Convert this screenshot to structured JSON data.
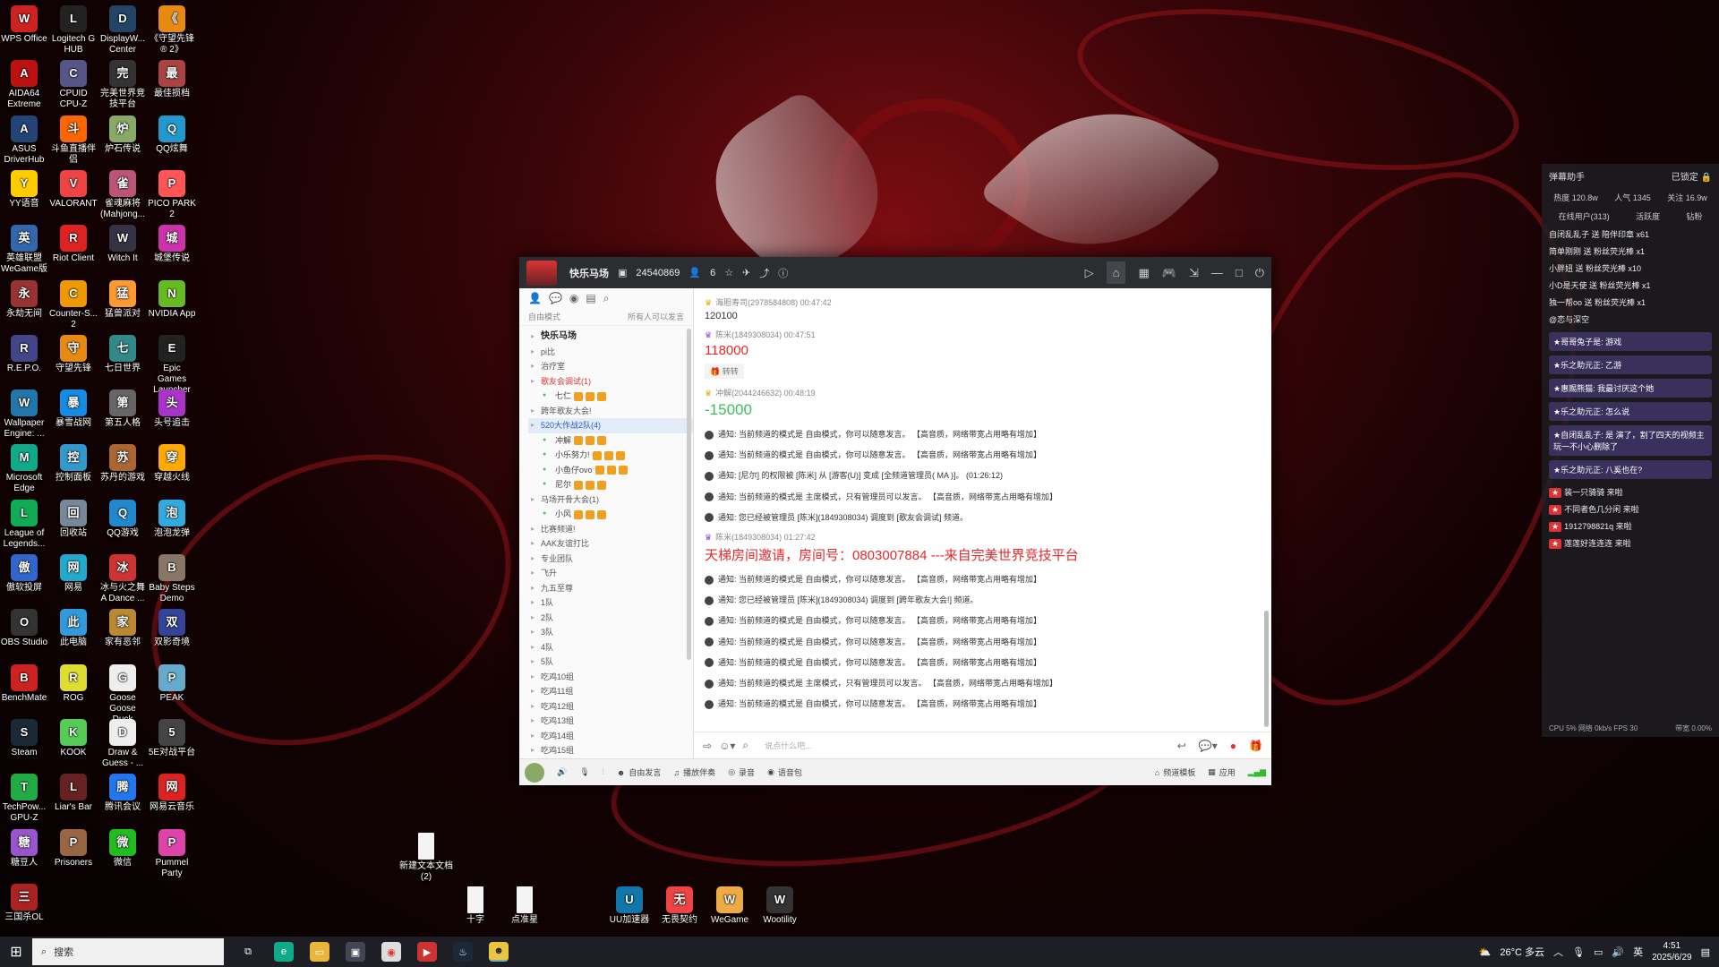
{
  "desktop": {
    "icons": [
      {
        "label": "WPS Office",
        "color": "#c22"
      },
      {
        "label": "Logitech G HUB",
        "color": "#222"
      },
      {
        "label": "DisplayW... Center",
        "color": "#246"
      },
      {
        "label": "《守望先锋® 2》",
        "color": "#e78a14"
      },
      {
        "label": "AIDA64 Extreme",
        "color": "#b11"
      },
      {
        "label": "CPUID CPU-Z",
        "color": "#558"
      },
      {
        "label": "完美世界竞技平台",
        "color": "#333"
      },
      {
        "label": "最佳损档",
        "color": "#a44"
      },
      {
        "label": "ASUS DriverHub",
        "color": "#247"
      },
      {
        "label": "斗鱼直播伴侣",
        "color": "#f60"
      },
      {
        "label": "炉石传说",
        "color": "#8a6"
      },
      {
        "label": "QQ炫舞",
        "color": "#29c"
      },
      {
        "label": "YY语音",
        "color": "#fc0"
      },
      {
        "label": "VALORANT",
        "color": "#e44"
      },
      {
        "label": "雀魂麻将(Mahjong...",
        "color": "#b57"
      },
      {
        "label": "PICO PARK 2",
        "color": "#f55"
      },
      {
        "label": "英雄联盟WeGame版",
        "color": "#36a"
      },
      {
        "label": "Riot Client",
        "color": "#d22"
      },
      {
        "label": "Witch It",
        "color": "#334"
      },
      {
        "label": "城堡传说",
        "color": "#c3a"
      },
      {
        "label": "永劫无间",
        "color": "#933"
      },
      {
        "label": "Counter-S... 2",
        "color": "#e90"
      },
      {
        "label": "猛兽派对",
        "color": "#f93"
      },
      {
        "label": "NVIDIA App",
        "color": "#6b2"
      },
      {
        "label": "R.E.P.O.",
        "color": "#448"
      },
      {
        "label": "守望先锋",
        "color": "#e78a14"
      },
      {
        "label": "七日世界",
        "color": "#388"
      },
      {
        "label": "Epic Games Launcher",
        "color": "#222"
      },
      {
        "label": "Wallpaper Engine: ...",
        "color": "#27a"
      },
      {
        "label": "暴雪战网",
        "color": "#148be5"
      },
      {
        "label": "第五人格",
        "color": "#666"
      },
      {
        "label": "头号追击",
        "color": "#a3c"
      },
      {
        "label": "Microsoft Edge",
        "color": "#1a8"
      },
      {
        "label": "控制面板",
        "color": "#39c"
      },
      {
        "label": "苏丹的游戏",
        "color": "#a63"
      },
      {
        "label": "穿越火线",
        "color": "#fa0"
      },
      {
        "label": "League of Legends...",
        "color": "#1a5"
      },
      {
        "label": "回收站",
        "color": "#789"
      },
      {
        "label": "QQ游戏",
        "color": "#28c"
      },
      {
        "label": "泡泡龙弹",
        "color": "#3ad"
      },
      {
        "label": "傲软投屏",
        "color": "#36c"
      },
      {
        "label": "网易",
        "color": "#2ac"
      },
      {
        "label": "冰与火之舞 A Dance ...",
        "color": "#c33"
      },
      {
        "label": "Baby Steps Demo",
        "color": "#876"
      },
      {
        "label": "OBS Studio",
        "color": "#333"
      },
      {
        "label": "此电脑",
        "color": "#39d"
      },
      {
        "label": "家有恶邻",
        "color": "#b83"
      },
      {
        "label": "双影奇境",
        "color": "#349"
      },
      {
        "label": "BenchMate",
        "color": "#c22"
      },
      {
        "label": "ROG",
        "color": "#dd3"
      },
      {
        "label": "Goose Goose Duck",
        "color": "#eee"
      },
      {
        "label": "PEAK",
        "color": "#6ac"
      },
      {
        "label": "Steam",
        "color": "#1b2838"
      },
      {
        "label": "KOOK",
        "color": "#5c5"
      },
      {
        "label": "Draw & Guess - ...",
        "color": "#eee"
      },
      {
        "label": "5E对战平台",
        "color": "#444"
      },
      {
        "label": "TechPow... GPU-Z",
        "color": "#2a4"
      },
      {
        "label": "Liar's Bar",
        "color": "#622"
      },
      {
        "label": "腾讯会议",
        "color": "#27e"
      },
      {
        "label": "网易云音乐",
        "color": "#d22"
      },
      {
        "label": "糖豆人",
        "color": "#95c"
      },
      {
        "label": "Prisoners",
        "color": "#964"
      },
      {
        "label": "微信",
        "color": "#2b2"
      },
      {
        "label": "Pummel Party",
        "color": "#d4a"
      },
      {
        "label": "三国杀OL",
        "color": "#a22"
      }
    ],
    "files": [
      {
        "label": "新建文本文档 (2)"
      },
      {
        "label": "十字"
      },
      {
        "label": "点准星"
      }
    ],
    "pinned": [
      {
        "label": "UU加速器",
        "color": "#17a"
      },
      {
        "label": "无畏契约",
        "color": "#e44"
      },
      {
        "label": "WeGame",
        "color": "#ea4"
      },
      {
        "label": "Wootility",
        "color": "#333"
      }
    ]
  },
  "app": {
    "channel_name": "快乐马场",
    "channel_id": "24540869",
    "user_count": "6",
    "mode": "自由模式",
    "mode_hint": "所有人可以发言",
    "channels": [
      {
        "name": "快乐马场",
        "kind": "root"
      },
      {
        "name": "pi比",
        "kind": "normal"
      },
      {
        "name": "治疗室",
        "kind": "normal"
      },
      {
        "name": "歌友会调试(1)",
        "kind": "red"
      },
      {
        "name": "七仁",
        "kind": "member"
      },
      {
        "name": "跨年歌友大会!",
        "kind": "normal"
      },
      {
        "name": "520大作战2队(4)",
        "kind": "sel"
      },
      {
        "name": "冲解",
        "kind": "member"
      },
      {
        "name": "小乐努力!",
        "kind": "member"
      },
      {
        "name": "小鱼仔ovo",
        "kind": "member"
      },
      {
        "name": "尼尔",
        "kind": "member"
      },
      {
        "name": "马场开骨大会(1)",
        "kind": "normal"
      },
      {
        "name": "小风",
        "kind": "member"
      },
      {
        "name": "比赛频道!",
        "kind": "normal"
      },
      {
        "name": "AAK友谊打比",
        "kind": "normal"
      },
      {
        "name": "专业团队",
        "kind": "normal"
      },
      {
        "name": "飞升",
        "kind": "normal"
      },
      {
        "name": "九五至尊",
        "kind": "normal"
      },
      {
        "name": "1队",
        "kind": "normal"
      },
      {
        "name": "2队",
        "kind": "normal"
      },
      {
        "name": "3队",
        "kind": "normal"
      },
      {
        "name": "4队",
        "kind": "normal"
      },
      {
        "name": "5队",
        "kind": "normal"
      },
      {
        "name": "吃鸡10组",
        "kind": "normal"
      },
      {
        "name": "吃鸡11组",
        "kind": "normal"
      },
      {
        "name": "吃鸡12组",
        "kind": "normal"
      },
      {
        "name": "吃鸡13组",
        "kind": "normal"
      },
      {
        "name": "吃鸡14组",
        "kind": "normal"
      },
      {
        "name": "吃鸡15组",
        "kind": "normal"
      }
    ],
    "messages": {
      "m1_head": "海胆寿司(2978584808)  00:47:42",
      "m1_body": "120100",
      "m2_head": "陈米(1849308034)  00:47:51",
      "m2_big": "118000",
      "m2_gift": "转转",
      "m3_head": "冲解(2044246632)  00:48:19",
      "m3_big": "-15000",
      "notices_a": [
        "通知: 当前频道的模式是 自由模式，你可以随意发言。 【高音质，网络带宽占用略有增加】",
        "通知: 当前频道的模式是 自由模式，你可以随意发言。 【高音质，网络带宽占用略有增加】",
        "通知: [尼尔] 的权限被 [陈米] 从 [游客(U)] 变成 [全频道管理员( MA )]。 (01:26:12)",
        "通知: 当前频道的模式是 主席模式，只有管理员可以发言。 【高音质，网络带宽占用略有增加】",
        "通知: 您已经被管理员 [陈米](1849308034) 调度到 [歌友会调试] 频道。"
      ],
      "m4_head": "陈米(1849308034)  01:27:42",
      "m4_big": "天梯房间邀请，房间号：0803007884 ---来自完美世界竞技平台",
      "notices_b": [
        "通知: 当前频道的模式是 自由模式，你可以随意发言。 【高音质，网络带宽占用略有增加】",
        "通知: 您已经被管理员 [陈米](1849308034) 调度到 [跨年歌友大会!] 频道。",
        "通知: 当前频道的模式是 自由模式，你可以随意发言。 【高音质，网络带宽占用略有增加】",
        "通知: 当前频道的模式是 自由模式，你可以随意发言。 【高音质，网络带宽占用略有增加】",
        "通知: 当前频道的模式是 自由模式，你可以随意发言。 【高音质，网络带宽占用略有增加】",
        "通知: 当前频道的模式是 主席模式，只有管理员可以发言。 【高音质，网络带宽占用略有增加】",
        "通知: 当前频道的模式是 自由模式，你可以随意发言。 【高音质，网络带宽占用略有增加】"
      ]
    },
    "input_placeholder": "说点什么吧...",
    "bottom": {
      "free_speech": "自由发言",
      "play_accomp": "播放伴奏",
      "record": "录音",
      "voice_pack": "语音包",
      "channel_template": "频道模板",
      "apps": "应用"
    }
  },
  "danmaku": {
    "title": "弹幕助手",
    "locked": "已锁定",
    "heat": "热度 120.8w",
    "popularity": "人气 1345",
    "follow": "关注 16.9w",
    "online": "在线用户(313)",
    "tab_active": "活跃度",
    "tab_gift": "钻粉",
    "rows": [
      "自闭乱乱子 送 陪伴印章 x61",
      "简单刚刚 送 粉丝荧光棒 x1",
      "小胖妞 送 粉丝荧光棒 x10",
      "小D是天使 送 粉丝荧光棒 x1",
      "独一帮oo 送 粉丝荧光棒 x1",
      "@恋与深空",
      "哥哥兔子是: 游戏",
      "乐之助元正: 乙游",
      "惠赐熊猫: 我最讨厌这个她",
      "乐之助元正: 怎么说",
      "自闭乱乱子: 是 演了，割了四天的视频主玩一不小心删除了",
      "乐之助元正: 八奚也在?",
      "装一只骑骑 来啦",
      "不同者色几分闲 来啦",
      "1912798821q 来啦",
      "莲莲好连连连 来啦"
    ],
    "footer_left": "CPU 5%  网络 0kb/s FPS 30",
    "footer_right": "带宽 0.00%"
  },
  "taskbar": {
    "search_placeholder": "搜索",
    "weather": "26°C 多云",
    "ime": "英",
    "time": "4:51",
    "date": "2025/6/29"
  }
}
